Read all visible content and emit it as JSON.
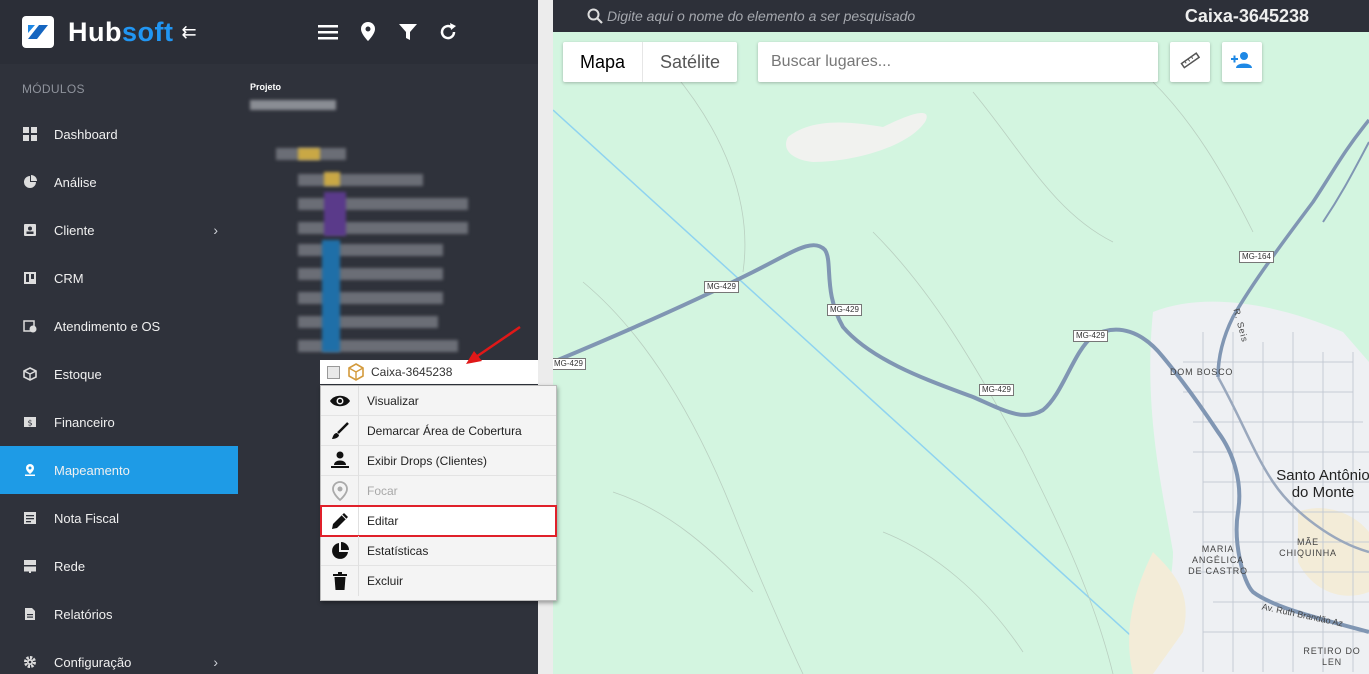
{
  "brand": {
    "name_main": "Hub",
    "name_accent": "soft"
  },
  "sidebar": {
    "section_label": "MÓDULOS",
    "items": [
      {
        "label": "Dashboard",
        "icon": "dashboard-icon"
      },
      {
        "label": "Análise",
        "icon": "pie-chart-icon"
      },
      {
        "label": "Cliente",
        "icon": "contact-card-icon",
        "has_submenu": true
      },
      {
        "label": "CRM",
        "icon": "kanban-icon"
      },
      {
        "label": "Atendimento e OS",
        "icon": "calendar-clock-icon"
      },
      {
        "label": "Estoque",
        "icon": "box-icon"
      },
      {
        "label": "Financeiro",
        "icon": "money-icon"
      },
      {
        "label": "Mapeamento",
        "icon": "map-pin-icon",
        "active": true
      },
      {
        "label": "Nota Fiscal",
        "icon": "receipt-icon"
      },
      {
        "label": "Rede",
        "icon": "server-icon"
      },
      {
        "label": "Relatórios",
        "icon": "report-icon"
      },
      {
        "label": "Configuração",
        "icon": "gear-icon",
        "has_submenu": true
      }
    ]
  },
  "panel": {
    "toolbar": [
      "menu-icon",
      "location-pin-icon",
      "filter-icon",
      "refresh-icon"
    ],
    "project_label": "Projeto"
  },
  "map": {
    "search_placeholder": "Digite aqui o nome do elemento a ser pesquisado",
    "title": "Caixa-3645238",
    "map_type": {
      "map": "Mapa",
      "satellite": "Satélite"
    },
    "places_placeholder": "Buscar lugares...",
    "road_labels": [
      "MG-429",
      "MG-429",
      "MG-429",
      "MG-429",
      "MG-429",
      "MG-164"
    ],
    "street_labels": [
      "R. Seis",
      "Av. Ruth Brandão Az"
    ],
    "places": [
      "DOM BOSCO",
      "MARIA ANGÉLICA DE CASTRO",
      "MÃE CHIQUINHA",
      "RETIRO DO LEN"
    ],
    "city": "Santo Antônio do Monte",
    "colors": {
      "land": "#d3f5e0",
      "road": "#8096b3",
      "water_line": "#8fd3f0"
    }
  },
  "tree_node": {
    "label": "Caixa-3645238",
    "icon": "cube-icon"
  },
  "context_menu": [
    {
      "label": "Visualizar",
      "icon": "eye-icon"
    },
    {
      "label": "Demarcar Área de Cobertura",
      "icon": "brush-icon"
    },
    {
      "label": "Exibir Drops (Clientes)",
      "icon": "person-drop-icon"
    },
    {
      "label": "Focar",
      "icon": "focus-pin-icon",
      "disabled": true
    },
    {
      "label": "Editar",
      "icon": "pencil-icon",
      "highlighted": true
    },
    {
      "label": "Estatísticas",
      "icon": "pie-chart-icon"
    },
    {
      "label": "Excluir",
      "icon": "trash-icon"
    }
  ]
}
